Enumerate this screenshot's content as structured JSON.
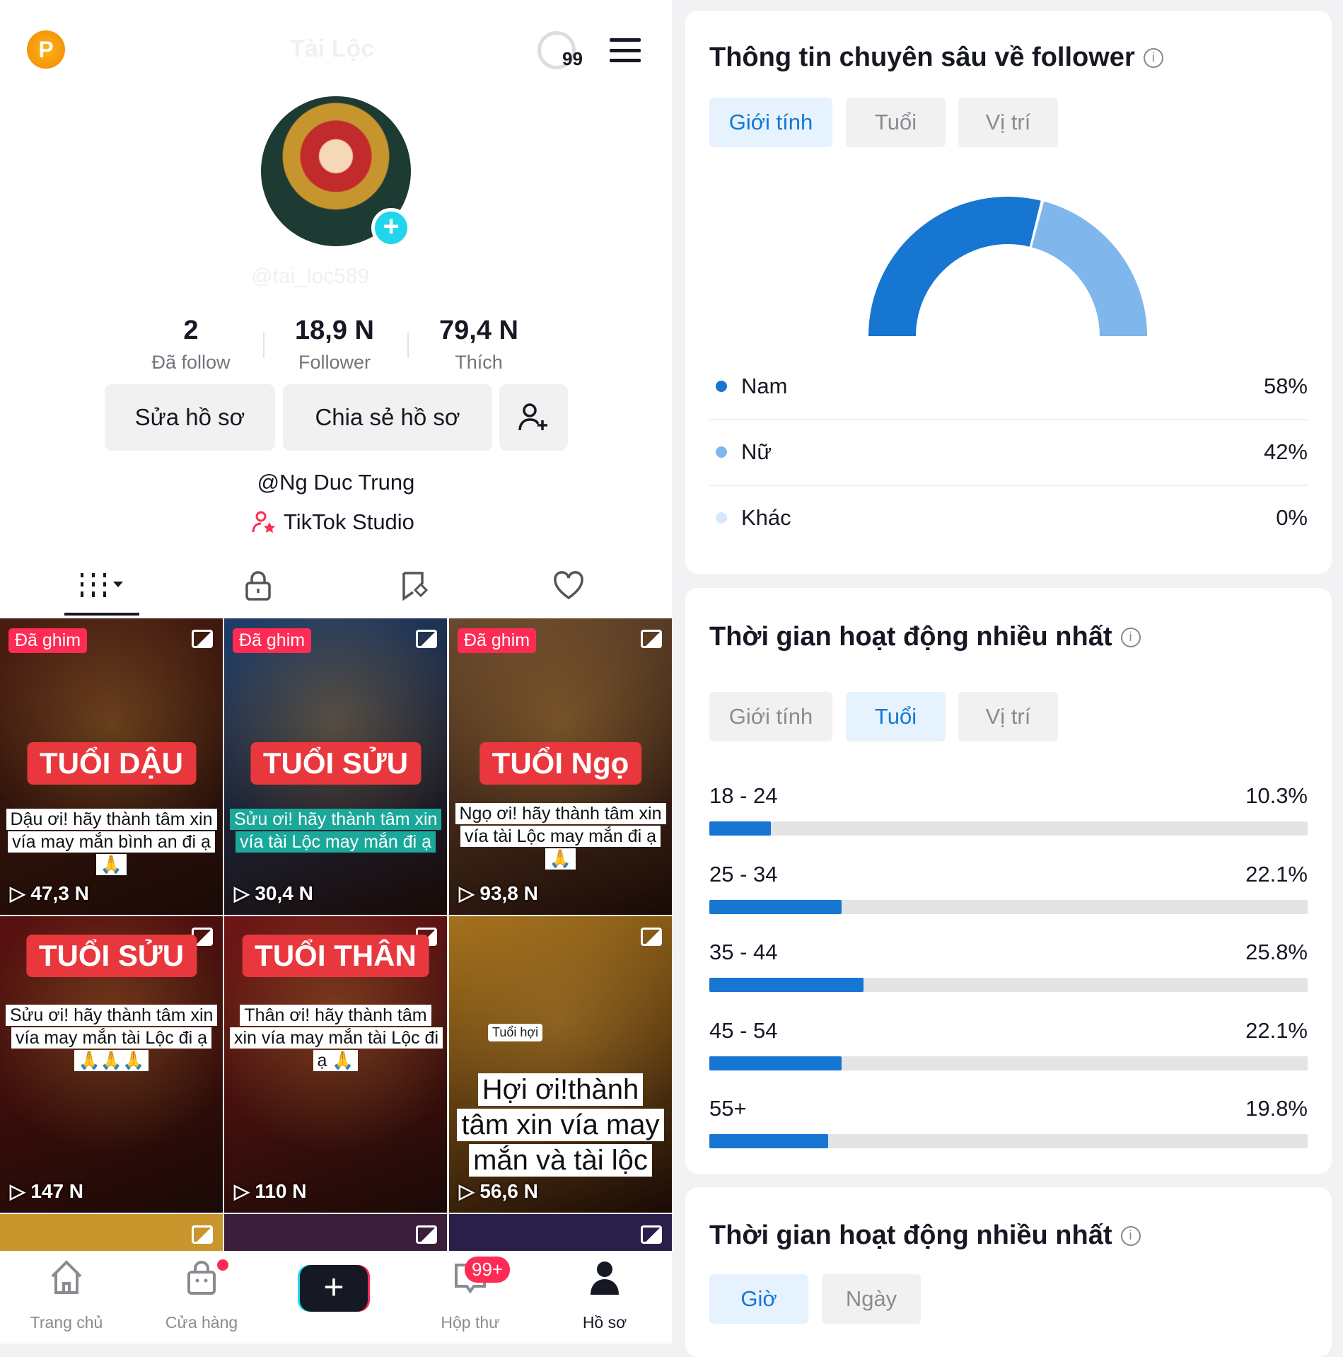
{
  "profile": {
    "coin_label": "P",
    "display_name": "Tài Lộc",
    "username": "@tai_loc589",
    "notification_count": "99",
    "stats": [
      {
        "value": "2",
        "label": "Đã follow"
      },
      {
        "value": "18,9 N",
        "label": "Follower"
      },
      {
        "value": "79,4 N",
        "label": "Thích"
      }
    ],
    "buttons": {
      "edit": "Sửa hồ sơ",
      "share": "Chia sẻ hồ sơ"
    },
    "bio": "@Ng Duc Trung",
    "studio_link": "TikTok Studio"
  },
  "videos": [
    {
      "pinned": "Đã ghim",
      "title": "TUỔI DẬU",
      "caption": "Dậu ơi! hãy thành tâm xin vía may mắn bình an đi ạ 🙏",
      "views": "47,3 N",
      "bg": "#4a1d12"
    },
    {
      "pinned": "Đã ghim",
      "title": "TUỔI SỬU",
      "caption": "Sửu ơi! hãy thành tâm xin vía tài Lộc may mắn đi ạ",
      "views": "30,4 N",
      "bg": "#1f3e6a",
      "teal": true
    },
    {
      "pinned": "Đã ghim",
      "title": "TUỔI Ngọ",
      "caption": "Ngọ ơi! hãy thành tâm xin vía tài Lộc may mắn đi ạ 🙏",
      "views": "93,8 N",
      "bg": "#6b4a2e"
    },
    {
      "title": "TUỔI SỬU",
      "caption": "Sửu ơi! hãy thành tâm xin vía may mắn tài Lộc đi ạ 🙏🙏🙏",
      "views": "147 N",
      "bg": "#5a1010"
    },
    {
      "title": "TUỔI THÂN",
      "caption": "Thân ơi! hãy thành tâm xin vía may mắn tài Lộc đi ạ 🙏",
      "views": "110 N",
      "bg": "#701616"
    },
    {
      "tag": "Tuổi hợi",
      "caption": "Hợi ơi!thành tâm xin vía may mắn và tài lộc",
      "views": "56,6 N",
      "bg": "#a6721c",
      "big": true
    }
  ],
  "nav": [
    {
      "label": "Trang chủ",
      "icon": "home-icon"
    },
    {
      "label": "Cửa hàng",
      "icon": "shop-icon"
    },
    {
      "label": "",
      "icon": "create-icon"
    },
    {
      "label": "Hộp thư",
      "icon": "inbox-icon",
      "badge": "99+"
    },
    {
      "label": "Hồ sơ",
      "icon": "profile-icon",
      "active": true
    }
  ],
  "insights": {
    "title": "Thông tin chuyên sâu về follower",
    "tabs": [
      "Giới tính",
      "Tuổi",
      "Vị trí"
    ],
    "active_tab": "Giới tính",
    "gender": [
      {
        "label": "Nam",
        "value": "58%",
        "pct": 58,
        "color": "#1676d2"
      },
      {
        "label": "Nữ",
        "value": "42%",
        "pct": 42,
        "color": "#7fb6ec"
      },
      {
        "label": "Khác",
        "value": "0%",
        "pct": 0,
        "color": "#d6e9fa"
      }
    ]
  },
  "activity": {
    "title": "Thời gian hoạt động nhiều nhất",
    "tabs": [
      "Giới tính",
      "Tuổi",
      "Vị trí"
    ],
    "active_tab": "Tuổi",
    "ages": [
      {
        "label": "18 - 24",
        "value": "10.3%",
        "pct": 10.3
      },
      {
        "label": "25 - 34",
        "value": "22.1%",
        "pct": 22.1
      },
      {
        "label": "35 - 44",
        "value": "25.8%",
        "pct": 25.8
      },
      {
        "label": "45 - 54",
        "value": "22.1%",
        "pct": 22.1
      },
      {
        "label": "55+",
        "value": "19.8%",
        "pct": 19.8
      }
    ]
  },
  "activity2": {
    "title": "Thời gian hoạt động nhiều nhất",
    "tabs": [
      "Giờ",
      "Ngày"
    ],
    "active_tab": "Giờ"
  },
  "colors": {
    "accent": "#1676d2",
    "light": "#7fb6ec",
    "red": "#fe2c55"
  }
}
